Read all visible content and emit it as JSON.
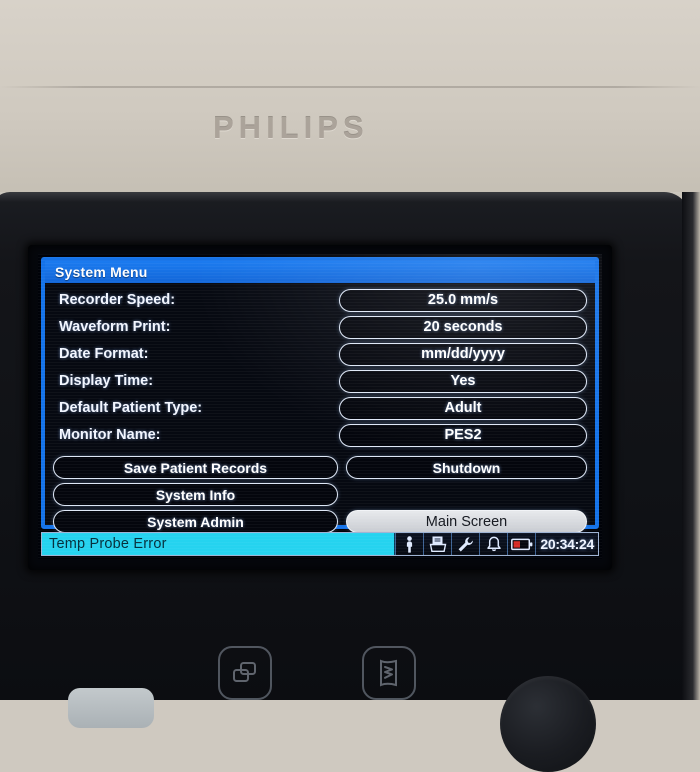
{
  "device": {
    "brand": "PHILIPS"
  },
  "screen": {
    "title": "System Menu",
    "settings": [
      {
        "label": "Recorder Speed:",
        "value": "25.0 mm/s"
      },
      {
        "label": "Waveform Print:",
        "value": "20 seconds"
      },
      {
        "label": "Date Format:",
        "value": "mm/dd/yyyy"
      },
      {
        "label": "Display Time:",
        "value": "Yes"
      },
      {
        "label": "Default Patient Type:",
        "value": "Adult"
      },
      {
        "label": "Monitor Name:",
        "value": "PES2"
      }
    ],
    "actions_left": [
      {
        "label": "Save Patient Records"
      },
      {
        "label": "System Info"
      },
      {
        "label": "System Admin"
      }
    ],
    "actions_right": [
      {
        "label": "Shutdown"
      },
      {
        "label": "Main Screen"
      }
    ],
    "statusbar": {
      "alarm_message": "Temp Probe Error",
      "time": "20:34:24",
      "icons": [
        "patient-icon",
        "printer-icon",
        "wrench-icon",
        "bell-icon",
        "battery-icon"
      ]
    }
  },
  "hardware": {
    "buttons": [
      "screens-button",
      "record-waveform-button",
      "soft-key-button",
      "rotary-knob"
    ]
  },
  "colors": {
    "title_blue": "#1472e8",
    "alarm_cyan": "#25d3ef",
    "battery_red": "#d42b25",
    "panel_black": "#060911"
  }
}
